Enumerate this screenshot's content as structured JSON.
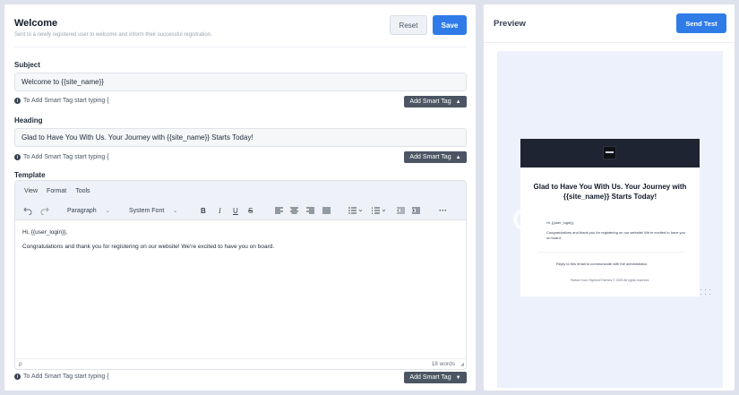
{
  "header": {
    "title": "Welcome",
    "subtitle": "Sent to a newly registered user to welcome and inform their successful registration.",
    "reset_label": "Reset",
    "save_label": "Save"
  },
  "subject": {
    "label": "Subject",
    "value": "Welcome to {{site_name}}",
    "hint": "To Add Smart Tag start typing {",
    "tag_button": "Add Smart Tag"
  },
  "heading": {
    "label": "Heading",
    "value": "Glad to Have You With Us. Your Journey with {{site_name}} Starts Today!",
    "hint": "To Add Smart Tag start typing {",
    "tag_button": "Add Smart Tag"
  },
  "template": {
    "label": "Template",
    "menu": [
      "View",
      "Format",
      "Tools"
    ],
    "block_format": "Paragraph",
    "font_family": "System Font",
    "content": [
      "Hi, {{user_login}},",
      "Congratulations and thank you for registering on our website! We're excited to have you on board."
    ],
    "status_path": "p",
    "word_count": "18 words",
    "hint": "To Add Smart Tag start typing {",
    "tag_button": "Add Smart Tag"
  },
  "preview": {
    "title": "Preview",
    "send_test_label": "Send Test",
    "email": {
      "heading": "Glad to Have You With Us. Your Journey with {{site_name}} Starts Today!",
      "greeting": "Hi, {{user_login}},",
      "body": "Congratulations and thank you for registering on our website! We're excited to have you on board.",
      "reply_note": "Reply to this email to communicate with the administrator.",
      "footer": "Partner from StylemixThemes © 2025 All rights reserved."
    }
  },
  "colors": {
    "accent": "#2f7ce8",
    "tag_button": "#4b5563",
    "email_header": "#1f2432",
    "canvas": "#edf1fb"
  }
}
